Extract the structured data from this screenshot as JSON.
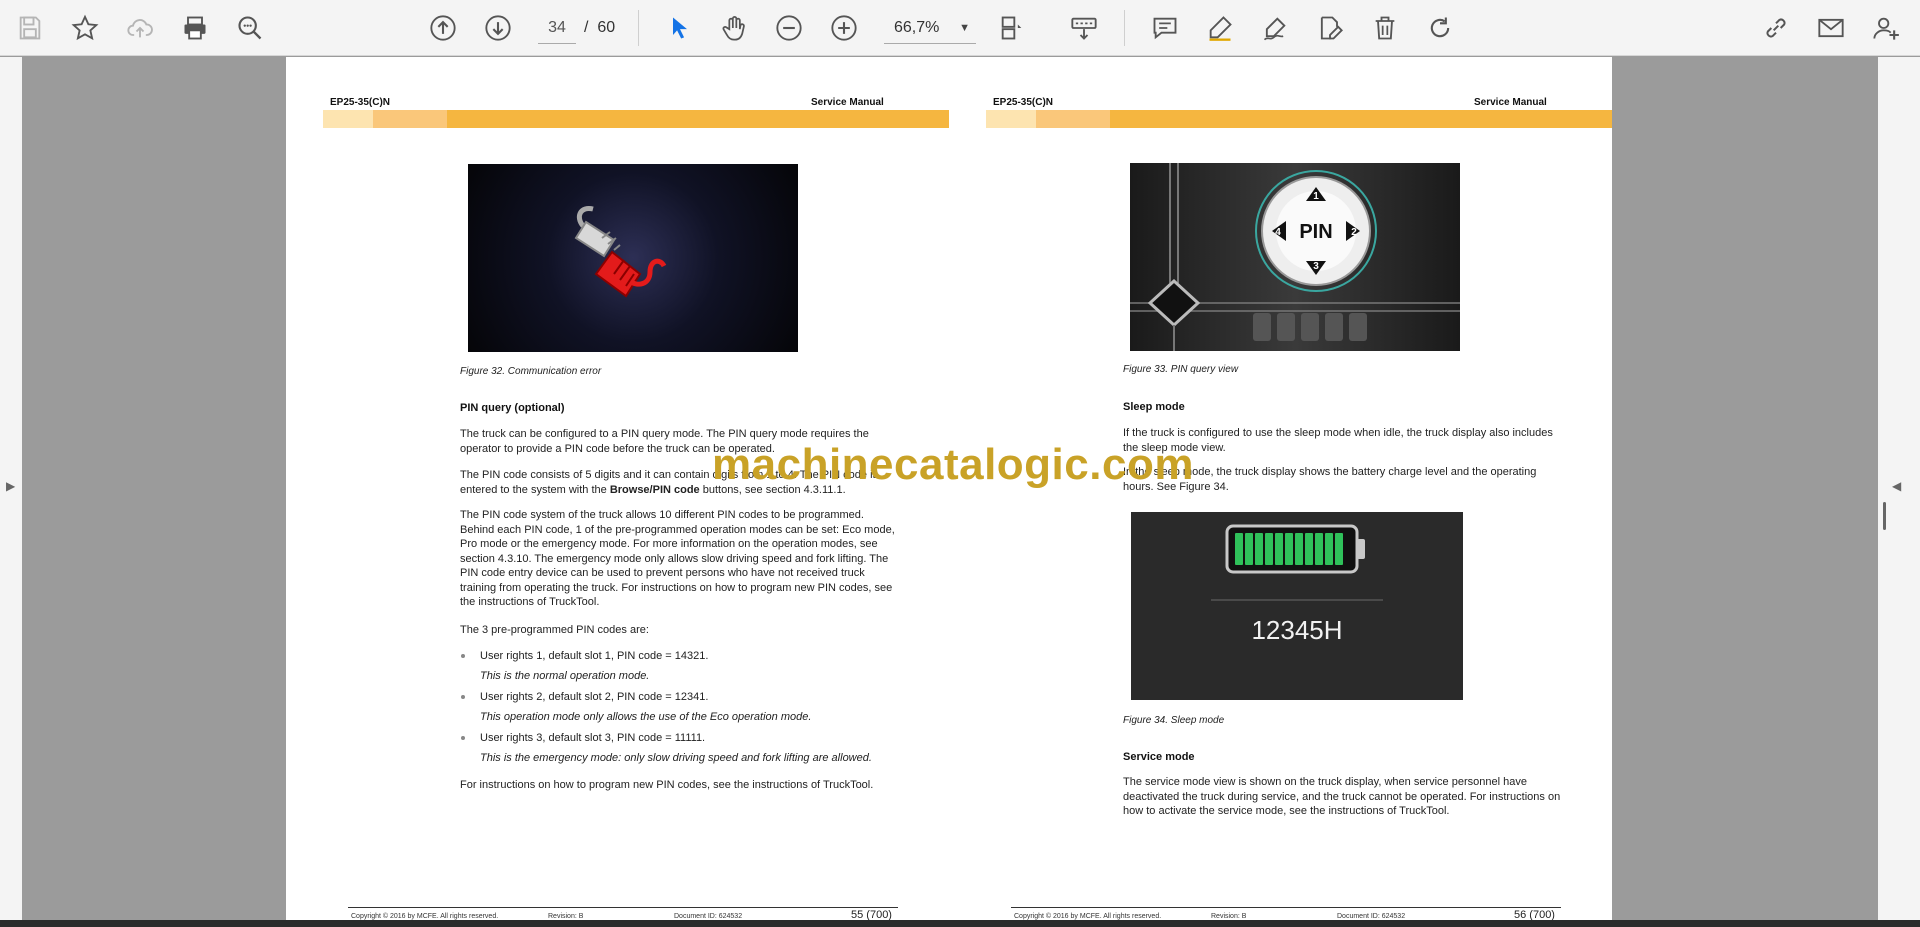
{
  "toolbar": {
    "page_current": "34",
    "page_sep": "/",
    "page_total": "60",
    "zoom": "66,7%"
  },
  "watermark": "machinecatalogic.com",
  "left_page": {
    "header_left": "EP25-35(C)N",
    "header_right": "Service Manual",
    "figure_caption": "Figure 32. Communication error",
    "heading": "PIN query (optional)",
    "para1": "The truck can be configured to a PIN query mode. The PIN query mode requires the operator to provide a PIN code before the truck can be operated.",
    "para2_a": "The PIN code consists of 5 digits and it can contain digits from 1 to 4. The PIN code is entered to the system with the ",
    "para2_b": "Browse/PIN code",
    "para2_c": " buttons, see section 4.3.11.1.",
    "para3": "The PIN code system of the truck allows 10 different PIN codes to be programmed. Behind each PIN code, 1 of the pre-programmed operation modes can be set: Eco mode, Pro mode or the emergency mode. For more information on the operation modes, see section 4.3.10. The emergency mode only allows slow driving speed and fork lifting. The PIN code entry device can be used to prevent persons who have not received truck training from operating the truck. For instructions on how to program new PIN codes, see the instructions of TruckTool.",
    "para4": "The 3 pre-programmed PIN codes are:",
    "items": [
      {
        "label": "User rights 1, default slot 1, PIN code = 14321.",
        "note": "This is the normal operation mode."
      },
      {
        "label": "User rights 2, default slot 2, PIN code = 12341.",
        "note": "This operation mode only allows the use of the Eco operation mode."
      },
      {
        "label": "User rights 3, default slot 3, PIN code = 11111.",
        "note": "This is the emergency mode: only slow driving speed and fork lifting are allowed."
      }
    ],
    "para5": "For instructions on how to program new PIN codes, see the instructions of TruckTool.",
    "footer_copyright": "Copyright © 2016 by MCFE. All rights reserved.",
    "footer_revision": "Revision: B",
    "footer_doc": "Document ID: 624532",
    "footer_page": "55 (700)"
  },
  "right_page": {
    "header_left": "EP25-35(C)N",
    "header_right": "Service Manual",
    "pin_label": "PIN",
    "pin_digits": [
      "1",
      "2",
      "3",
      "4"
    ],
    "figure33_caption": "Figure 33. PIN query view",
    "heading_sleep": "Sleep mode",
    "sleep_para1": "If the truck is configured to use the sleep mode when idle, the truck display also includes the sleep mode view.",
    "sleep_para2": "In the sleep mode, the truck display shows the battery charge level and the operating hours. See Figure 34.",
    "hours": "12345H",
    "figure34_caption": "Figure 34. Sleep mode",
    "heading_service": "Service mode",
    "service_para": "The service mode view is shown on the truck display, when service personnel have deactivated the truck during service, and the truck cannot be operated. For instructions on how to activate the service mode, see the instructions of TruckTool.",
    "footer_copyright": "Copyright © 2016 by MCFE. All rights reserved.",
    "footer_revision": "Revision: B",
    "footer_doc": "Document ID: 624532",
    "footer_page": "56 (700)"
  },
  "colors": {
    "band_main": "#f5b640",
    "band_light": "#fde4b0",
    "watermark": "#c9a227",
    "battery_green": "#2fc15a"
  }
}
